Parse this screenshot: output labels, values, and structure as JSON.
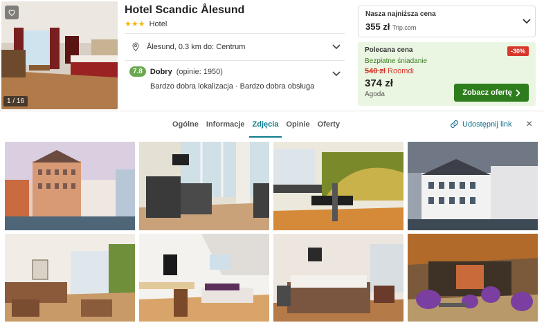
{
  "hotel": {
    "name": "Hotel Scandic Ålesund",
    "stars": "★★★",
    "type": "Hotel",
    "location": "Ålesund, 0.3 km do: Centrum",
    "rating_score": "7.8",
    "rating_label": "Dobry",
    "rating_count": "(opinie: 1950)",
    "rating_highlights": "Bardzo dobra lokalizacja · Bardzo dobra obsługa",
    "photo_counter": "1 / 16"
  },
  "pricing": {
    "lowest_label": "Nasza najniższa cena",
    "lowest_price": "355 zł",
    "lowest_provider": "Trip.com",
    "recommended_label": "Polecana cena",
    "discount": "-30%",
    "breakfast": "Bezpłatne śniadanie",
    "old_price": "540 zł",
    "old_provider": "Roomdi",
    "new_price": "374 zł",
    "new_provider": "Agoda",
    "cta_label": "Zobacz ofertę"
  },
  "tabs": {
    "items": [
      {
        "label": "Ogólne",
        "active": false
      },
      {
        "label": "Informacje",
        "active": false
      },
      {
        "label": "Zdjęcia",
        "active": true
      },
      {
        "label": "Opinie",
        "active": false
      },
      {
        "label": "Oferty",
        "active": false
      }
    ],
    "share_label": "Udostępnij link",
    "close_glyph": "×"
  },
  "colors": {
    "accent": "#0d7b8c",
    "cta": "#2e7d1c",
    "discount": "#d9372b",
    "rating_badge": "#6aa84f",
    "recommended_bg": "#eaf6e2",
    "stars": "#f7b500"
  },
  "icons": {
    "favorite": "heart-icon",
    "location": "map-pin-icon",
    "expand": "chevron-down-icon",
    "cta": "chevron-right-icon",
    "share": "link-icon",
    "close": "close-icon"
  }
}
